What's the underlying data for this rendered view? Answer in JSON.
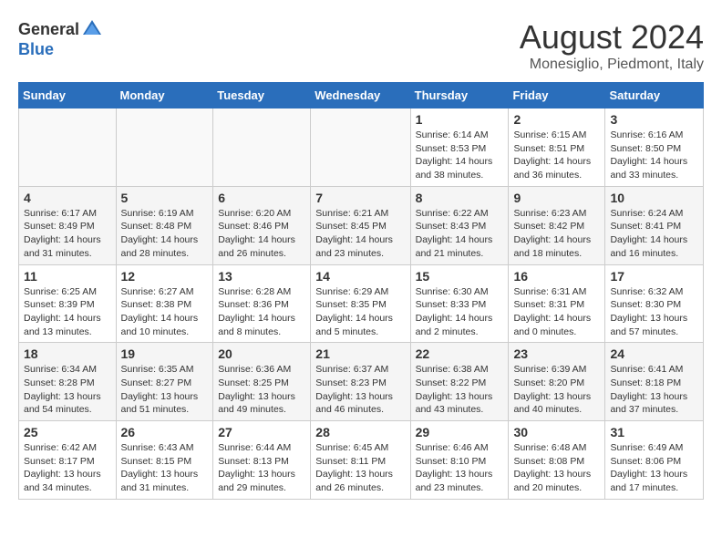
{
  "header": {
    "logo_general": "General",
    "logo_blue": "Blue",
    "month_year": "August 2024",
    "location": "Monesiglio, Piedmont, Italy"
  },
  "weekdays": [
    "Sunday",
    "Monday",
    "Tuesday",
    "Wednesday",
    "Thursday",
    "Friday",
    "Saturday"
  ],
  "weeks": [
    [
      {
        "day": "",
        "info": ""
      },
      {
        "day": "",
        "info": ""
      },
      {
        "day": "",
        "info": ""
      },
      {
        "day": "",
        "info": ""
      },
      {
        "day": "1",
        "info": "Sunrise: 6:14 AM\nSunset: 8:53 PM\nDaylight: 14 hours\nand 38 minutes."
      },
      {
        "day": "2",
        "info": "Sunrise: 6:15 AM\nSunset: 8:51 PM\nDaylight: 14 hours\nand 36 minutes."
      },
      {
        "day": "3",
        "info": "Sunrise: 6:16 AM\nSunset: 8:50 PM\nDaylight: 14 hours\nand 33 minutes."
      }
    ],
    [
      {
        "day": "4",
        "info": "Sunrise: 6:17 AM\nSunset: 8:49 PM\nDaylight: 14 hours\nand 31 minutes."
      },
      {
        "day": "5",
        "info": "Sunrise: 6:19 AM\nSunset: 8:48 PM\nDaylight: 14 hours\nand 28 minutes."
      },
      {
        "day": "6",
        "info": "Sunrise: 6:20 AM\nSunset: 8:46 PM\nDaylight: 14 hours\nand 26 minutes."
      },
      {
        "day": "7",
        "info": "Sunrise: 6:21 AM\nSunset: 8:45 PM\nDaylight: 14 hours\nand 23 minutes."
      },
      {
        "day": "8",
        "info": "Sunrise: 6:22 AM\nSunset: 8:43 PM\nDaylight: 14 hours\nand 21 minutes."
      },
      {
        "day": "9",
        "info": "Sunrise: 6:23 AM\nSunset: 8:42 PM\nDaylight: 14 hours\nand 18 minutes."
      },
      {
        "day": "10",
        "info": "Sunrise: 6:24 AM\nSunset: 8:41 PM\nDaylight: 14 hours\nand 16 minutes."
      }
    ],
    [
      {
        "day": "11",
        "info": "Sunrise: 6:25 AM\nSunset: 8:39 PM\nDaylight: 14 hours\nand 13 minutes."
      },
      {
        "day": "12",
        "info": "Sunrise: 6:27 AM\nSunset: 8:38 PM\nDaylight: 14 hours\nand 10 minutes."
      },
      {
        "day": "13",
        "info": "Sunrise: 6:28 AM\nSunset: 8:36 PM\nDaylight: 14 hours\nand 8 minutes."
      },
      {
        "day": "14",
        "info": "Sunrise: 6:29 AM\nSunset: 8:35 PM\nDaylight: 14 hours\nand 5 minutes."
      },
      {
        "day": "15",
        "info": "Sunrise: 6:30 AM\nSunset: 8:33 PM\nDaylight: 14 hours\nand 2 minutes."
      },
      {
        "day": "16",
        "info": "Sunrise: 6:31 AM\nSunset: 8:31 PM\nDaylight: 14 hours\nand 0 minutes."
      },
      {
        "day": "17",
        "info": "Sunrise: 6:32 AM\nSunset: 8:30 PM\nDaylight: 13 hours\nand 57 minutes."
      }
    ],
    [
      {
        "day": "18",
        "info": "Sunrise: 6:34 AM\nSunset: 8:28 PM\nDaylight: 13 hours\nand 54 minutes."
      },
      {
        "day": "19",
        "info": "Sunrise: 6:35 AM\nSunset: 8:27 PM\nDaylight: 13 hours\nand 51 minutes."
      },
      {
        "day": "20",
        "info": "Sunrise: 6:36 AM\nSunset: 8:25 PM\nDaylight: 13 hours\nand 49 minutes."
      },
      {
        "day": "21",
        "info": "Sunrise: 6:37 AM\nSunset: 8:23 PM\nDaylight: 13 hours\nand 46 minutes."
      },
      {
        "day": "22",
        "info": "Sunrise: 6:38 AM\nSunset: 8:22 PM\nDaylight: 13 hours\nand 43 minutes."
      },
      {
        "day": "23",
        "info": "Sunrise: 6:39 AM\nSunset: 8:20 PM\nDaylight: 13 hours\nand 40 minutes."
      },
      {
        "day": "24",
        "info": "Sunrise: 6:41 AM\nSunset: 8:18 PM\nDaylight: 13 hours\nand 37 minutes."
      }
    ],
    [
      {
        "day": "25",
        "info": "Sunrise: 6:42 AM\nSunset: 8:17 PM\nDaylight: 13 hours\nand 34 minutes."
      },
      {
        "day": "26",
        "info": "Sunrise: 6:43 AM\nSunset: 8:15 PM\nDaylight: 13 hours\nand 31 minutes."
      },
      {
        "day": "27",
        "info": "Sunrise: 6:44 AM\nSunset: 8:13 PM\nDaylight: 13 hours\nand 29 minutes."
      },
      {
        "day": "28",
        "info": "Sunrise: 6:45 AM\nSunset: 8:11 PM\nDaylight: 13 hours\nand 26 minutes."
      },
      {
        "day": "29",
        "info": "Sunrise: 6:46 AM\nSunset: 8:10 PM\nDaylight: 13 hours\nand 23 minutes."
      },
      {
        "day": "30",
        "info": "Sunrise: 6:48 AM\nSunset: 8:08 PM\nDaylight: 13 hours\nand 20 minutes."
      },
      {
        "day": "31",
        "info": "Sunrise: 6:49 AM\nSunset: 8:06 PM\nDaylight: 13 hours\nand 17 minutes."
      }
    ]
  ]
}
